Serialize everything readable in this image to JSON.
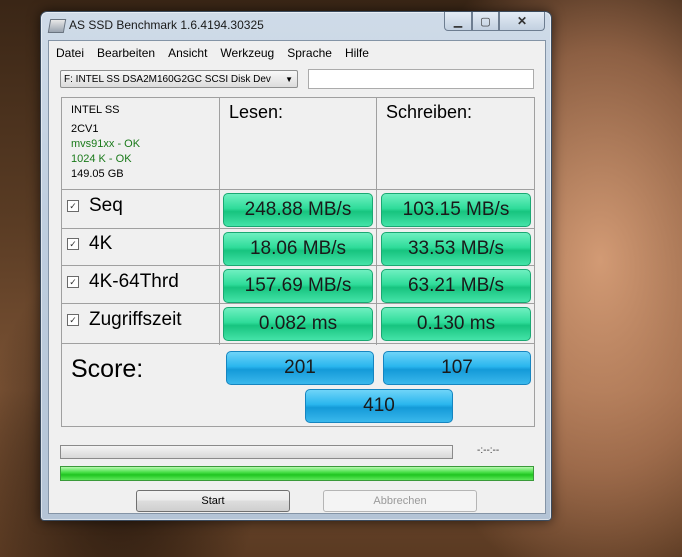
{
  "window": {
    "title": "AS SSD Benchmark 1.6.4194.30325"
  },
  "menu": [
    "Datei",
    "Bearbeiten",
    "Ansicht",
    "Werkzeug",
    "Sprache",
    "Hilfe"
  ],
  "drive": {
    "selected": "F: INTEL SS DSA2M160G2GC SCSI Disk Dev",
    "name": "INTEL SS",
    "firmware": "2CV1",
    "driver_status": "mvs91xx - OK",
    "alignment_status": "1024 K - OK",
    "capacity": "149.05 GB"
  },
  "columns": {
    "read": "Lesen:",
    "write": "Schreiben:"
  },
  "tests": [
    {
      "label": "Seq",
      "checked": true,
      "read": "248.88 MB/s",
      "write": "103.15 MB/s"
    },
    {
      "label": "4K",
      "checked": true,
      "read": "18.06 MB/s",
      "write": "33.53 MB/s"
    },
    {
      "label": "4K-64Thrd",
      "checked": true,
      "read": "157.69 MB/s",
      "write": "63.21 MB/s"
    },
    {
      "label": "Zugriffszeit",
      "checked": true,
      "read": "0.082 ms",
      "write": "0.130 ms"
    }
  ],
  "score": {
    "label": "Score:",
    "read": "201",
    "write": "107",
    "total": "410"
  },
  "progress": {
    "fraction": 0,
    "time": "-:--:--"
  },
  "buttons": {
    "start": "Start",
    "abort": "Abbrechen"
  },
  "icons": {
    "checkbox": "checkmark-icon",
    "dropdown": "chevron-down-icon"
  },
  "colors": {
    "result_green": "#2fdc9a",
    "score_blue": "#2ab6ee",
    "status_ok": "#1a7a1a"
  }
}
